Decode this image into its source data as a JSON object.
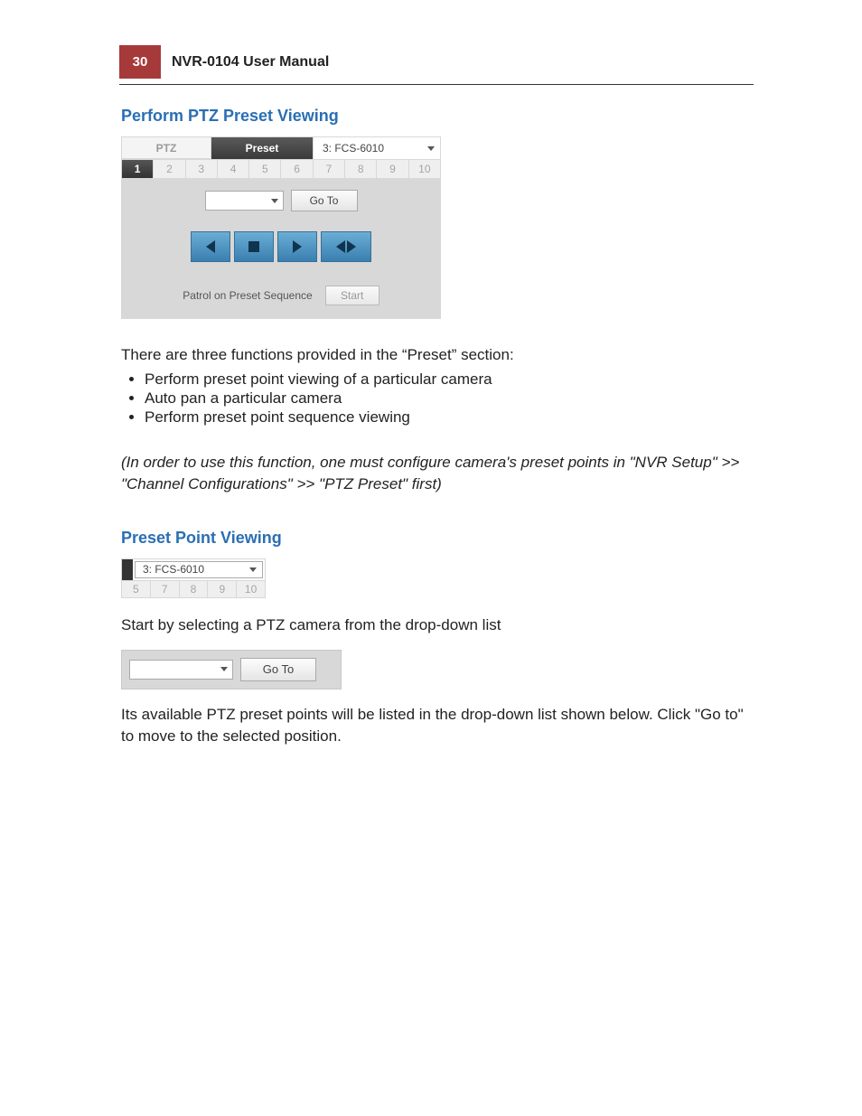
{
  "header": {
    "page_number": "30",
    "manual_title": "NVR-0104  User Manual"
  },
  "section1": {
    "heading": "Perform PTZ Preset Viewing",
    "panel": {
      "tab_ptz": "PTZ",
      "tab_preset": "Preset",
      "camera_selected": "3: FCS-6010",
      "numbers": [
        "1",
        "2",
        "3",
        "4",
        "5",
        "6",
        "7",
        "8",
        "9",
        "10"
      ],
      "goto_label": "Go To",
      "patrol_label": "Patrol on Preset Sequence",
      "start_label": "Start"
    },
    "intro": "There are three functions provided in the “Preset” section:",
    "bullets": [
      "Perform preset point viewing of a particular camera",
      "Auto pan a particular camera",
      "Perform preset point sequence viewing"
    ],
    "note": "(In order to use this function, one must configure camera's preset points in \"NVR Setup\" >> \"Channel Configurations\" >> \"PTZ Preset\" first)"
  },
  "section2": {
    "heading": "Preset Point Viewing",
    "dd_panel": {
      "camera_selected": "3: FCS-6010",
      "numbers": [
        "5",
        "7",
        "8",
        "9",
        "10"
      ]
    },
    "text1": "Start by selecting a PTZ camera from the drop-down list",
    "goto_label": "Go To",
    "text2": "Its available PTZ preset points will be listed in the drop-down list shown below. Click \"Go to\" to move to the selected position."
  }
}
